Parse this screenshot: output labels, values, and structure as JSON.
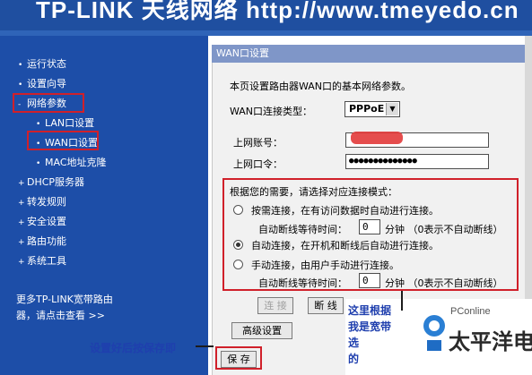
{
  "banner": {
    "text": "TP-LINK 天线网络 http://www.tmeyedo.cn"
  },
  "sidebar": {
    "items": [
      {
        "label": "运行状态",
        "bullet": "•"
      },
      {
        "label": "设置向导",
        "bullet": "•"
      },
      {
        "label": "网络参数",
        "bullet": "-"
      },
      {
        "label": "LAN口设置",
        "bullet": "•"
      },
      {
        "label": "WAN口设置",
        "bullet": "•"
      },
      {
        "label": "MAC地址克隆",
        "bullet": "•"
      },
      {
        "label": "DHCP服务器",
        "bullet": "+"
      },
      {
        "label": "转发规则",
        "bullet": "+"
      },
      {
        "label": "安全设置",
        "bullet": "+"
      },
      {
        "label": "路由功能",
        "bullet": "+"
      },
      {
        "label": "系统工具",
        "bullet": "+"
      }
    ],
    "footer_line1": "更多TP-LINK宽带路由",
    "footer_line2": "器，请点击查看 >>"
  },
  "panel": {
    "title": "WAN口设置",
    "intro": "本页设置路由器WAN口的基本网络参数。",
    "conn_type_label": "WAN口连接类型：",
    "conn_type_value": "PPPoE",
    "account_label": "上网账号：",
    "password_label": "上网口令：",
    "password_value": "●●●●●●●●●●●●●●",
    "mode_prompt": "根据您的需要，请选择对应连接模式：",
    "modes": [
      {
        "label": "按需连接，在有访问数据时自动进行连接。",
        "selected": false
      },
      {
        "label": "自动连接，在开机和断线后自动进行连接。",
        "selected": true
      },
      {
        "label": "手动连接，由用户手动进行连接。",
        "selected": false
      }
    ],
    "wait_label": "自动断线等待时间：",
    "wait_value": "0",
    "wait_unit": "分钟 （0表示不自动断线）",
    "connect_button": "连 接",
    "disconnect_button": "断 线",
    "advanced_button": "高级设置",
    "save_button": "保 存"
  },
  "annotations": {
    "save_hint": "设置好后按保存即",
    "side_note_1": "这里根据",
    "side_note_2": "我是宽带",
    "side_note_3": "选",
    "side_note_4": "的",
    "logo_brand": "PConline",
    "logo_chinese": "太平洋电脑"
  },
  "colors": {
    "sidebar_bg": "#1d4ea8",
    "panel_header": "#7f96c8",
    "highlight_red": "#d0202a",
    "annotation_blue": "#1f3fae"
  }
}
